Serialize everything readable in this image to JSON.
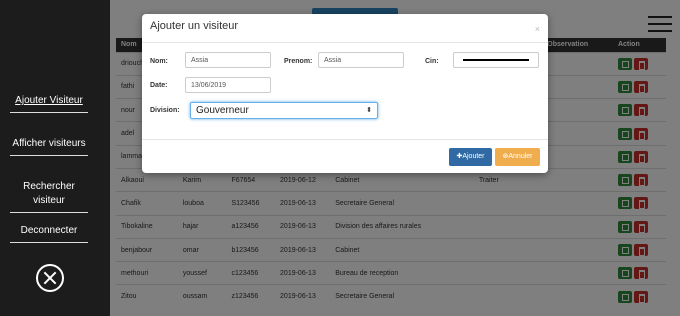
{
  "sidebar": {
    "items": [
      {
        "label": "Ajouter Visiteur"
      },
      {
        "label": "Afficher visiteurs"
      },
      {
        "label": "Rechercher visiteur"
      },
      {
        "label": "Deconnecter"
      }
    ]
  },
  "table": {
    "headers": [
      "Nom",
      "",
      "",
      "",
      "",
      "",
      "Observation",
      "Action"
    ],
    "rows": [
      [
        "driouch",
        "",
        "",
        "",
        "",
        "",
        ""
      ],
      [
        "fathi",
        "",
        "",
        "",
        "",
        "",
        ""
      ],
      [
        "nour",
        "",
        "",
        "",
        "",
        "",
        ""
      ],
      [
        "adel",
        "",
        "",
        "",
        "",
        "",
        ""
      ],
      [
        "lamma",
        "",
        "",
        "",
        "",
        "",
        ""
      ],
      [
        "Alkaoui",
        "Karim",
        "F67654",
        "2019-06-12",
        "Cabinet",
        "Traiter",
        ""
      ],
      [
        "Chafik",
        "louboa",
        "S123456",
        "2019-06-13",
        "Secretaire General",
        "",
        ""
      ],
      [
        "Tibokaline",
        "hajar",
        "a123456",
        "2019-06-13",
        "Division des affaires rurales",
        "",
        ""
      ],
      [
        "benjabour",
        "omar",
        "b123456",
        "2019-06-13",
        "Cabinet",
        "",
        ""
      ],
      [
        "methouri",
        "youssef",
        "c123456",
        "2019-06-13",
        "Bureau de reception",
        "",
        ""
      ],
      [
        "Zitou",
        "oussam",
        "z123456",
        "2019-06-13",
        "Secretaire General",
        "",
        ""
      ]
    ]
  },
  "modal": {
    "title": "Ajouter un visiteur",
    "close": "×",
    "labels": {
      "nom": "Nom:",
      "prenom": "Prenom:",
      "cin": "Cin:",
      "date": "Date:",
      "division": "Division:"
    },
    "values": {
      "nom": "Assia",
      "prenom": "Assia",
      "date": "13/06/2019",
      "division": "Gouverneur"
    },
    "buttons": {
      "add": "✚Ajouter",
      "cancel": "⊗Annuler"
    }
  },
  "colors": {
    "sidebar_bg": "#1c1c1c",
    "table_header_bg": "#333333",
    "btn_add": "#2f6aa5",
    "btn_cancel": "#f0ad4e",
    "btn_edit": "#2e8b3a",
    "btn_delete": "#c9302c"
  }
}
